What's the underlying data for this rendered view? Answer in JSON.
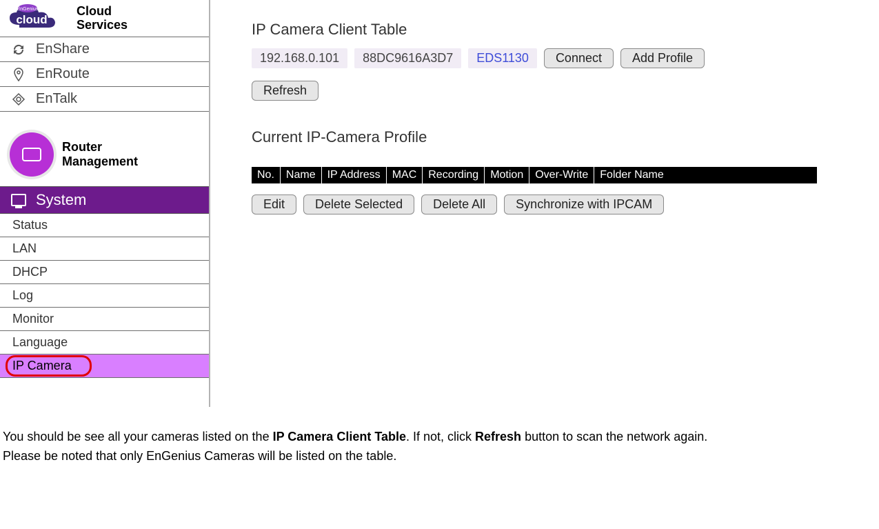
{
  "brand": {
    "line1": "Cloud",
    "line2": "Services",
    "badge": "EnGenius",
    "wordmark": "cloud"
  },
  "cloud_services": [
    {
      "icon": "sync-icon",
      "label": "EnShare"
    },
    {
      "icon": "pin-icon",
      "label": "EnRoute"
    },
    {
      "icon": "talk-icon",
      "label": "EnTalk"
    }
  ],
  "router_section": {
    "line1": "Router",
    "line2": "Management"
  },
  "system_label": "System",
  "menu": [
    {
      "label": "Status",
      "highlight": false
    },
    {
      "label": "LAN",
      "highlight": false
    },
    {
      "label": "DHCP",
      "highlight": false
    },
    {
      "label": "Log",
      "highlight": false
    },
    {
      "label": "Monitor",
      "highlight": false
    },
    {
      "label": "Language",
      "highlight": false
    },
    {
      "label": "IP Camera",
      "highlight": true
    }
  ],
  "client_table": {
    "title": "IP Camera Client Table",
    "ip": "192.168.0.101",
    "mac": "88DC9616A3D7",
    "model": "EDS1130",
    "connect": "Connect",
    "add_profile": "Add Profile",
    "refresh": "Refresh"
  },
  "profile": {
    "title": "Current IP-Camera Profile",
    "headers": [
      "No.",
      "Name",
      "IP Address",
      "MAC",
      "Recording",
      "Motion",
      "Over-Write",
      "Folder Name"
    ],
    "edit": "Edit",
    "delete_selected": "Delete Selected",
    "delete_all": "Delete All",
    "sync": "Synchronize with IPCAM"
  },
  "footer": {
    "p1a": "You should be see all your cameras listed on the ",
    "p1b": "IP Camera Client Table",
    "p1c": ". If not, click ",
    "p1d": "Refresh",
    "p1e": " button to scan the network again.",
    "p2": "Please be noted that only EnGenius Cameras will be listed on the table."
  }
}
